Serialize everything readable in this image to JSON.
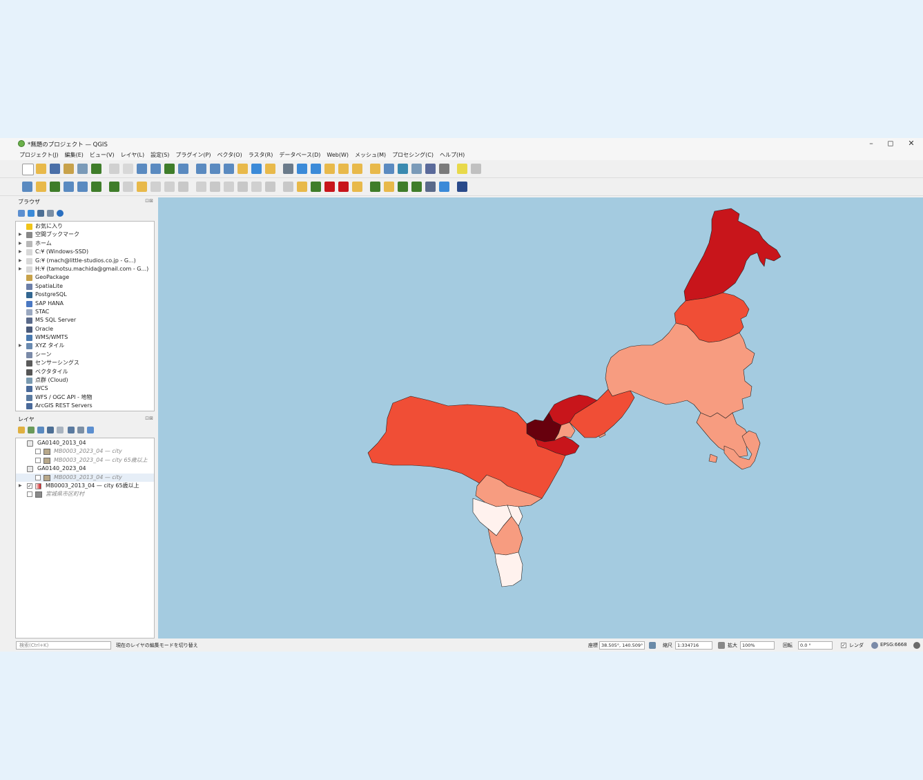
{
  "window": {
    "title": "*無題のプロジェクト — QGIS",
    "controls": {
      "minimize": "–",
      "maximize": "◻",
      "close": "✕"
    }
  },
  "menu": [
    "プロジェクト(J)",
    "編集(E)",
    "ビュー(V)",
    "レイヤ(L)",
    "設定(S)",
    "プラグイン(P)",
    "ベクタ(O)",
    "ラスタ(R)",
    "データベース(D)",
    "Web(W)",
    "メッシュ(M)",
    "プロセシング(C)",
    "ヘルプ(H)"
  ],
  "browser": {
    "title": "ブラウザ",
    "controls": "⊡⊠",
    "items": [
      {
        "label": "お気に入り",
        "icon": "star-icon",
        "color": "#f0c419",
        "expand": false
      },
      {
        "label": "空間ブックマーク",
        "icon": "bookmark-icon",
        "color": "#888888",
        "expand": true
      },
      {
        "label": "ホーム",
        "icon": "home-folder-icon",
        "color": "#b8b8b8",
        "expand": true
      },
      {
        "label": "C:¥ (Windows-SSD)",
        "icon": "drive-icon",
        "color": "#d8d8d8",
        "expand": true
      },
      {
        "label": "G:¥ (mach@little-studios.co.jp - G...)",
        "icon": "drive-icon",
        "color": "#d8d8d8",
        "expand": true
      },
      {
        "label": "H:¥ (tamotsu.machida@gmail.com - G...)",
        "icon": "drive-icon",
        "color": "#d8d8d8",
        "expand": true
      },
      {
        "label": "GeoPackage",
        "icon": "geopackage-icon",
        "color": "#c8a24a",
        "expand": false
      },
      {
        "label": "SpatiaLite",
        "icon": "spatialite-icon",
        "color": "#6c7fa8",
        "expand": false
      },
      {
        "label": "PostgreSQL",
        "icon": "postgresql-icon",
        "color": "#336791",
        "expand": false
      },
      {
        "label": "SAP HANA",
        "icon": "sap-hana-icon",
        "color": "#4a78c2",
        "expand": false
      },
      {
        "label": "STAC",
        "icon": "stac-icon",
        "color": "#9aa8c0",
        "expand": false
      },
      {
        "label": "MS SQL Server",
        "icon": "mssql-icon",
        "color": "#5a6a8a",
        "expand": false
      },
      {
        "label": "Oracle",
        "icon": "oracle-icon",
        "color": "#4a5a7a",
        "expand": false
      },
      {
        "label": "WMS/WMTS",
        "icon": "wms-icon",
        "color": "#4a7ab0",
        "expand": false
      },
      {
        "label": "XYZ タイル",
        "icon": "xyz-tiles-icon",
        "color": "#6a8ab0",
        "expand": true
      },
      {
        "label": "シーン",
        "icon": "scene-icon",
        "color": "#7a8aa8",
        "expand": false
      },
      {
        "label": "センサーシングス",
        "icon": "sensor-icon",
        "color": "#5a5a5a",
        "expand": false
      },
      {
        "label": "ベクタタイル",
        "icon": "vector-tile-icon",
        "color": "#555555",
        "expand": false
      },
      {
        "label": "点群 (Cloud)",
        "icon": "point-cloud-icon",
        "color": "#7a9ab0",
        "expand": false
      },
      {
        "label": "WCS",
        "icon": "wcs-icon",
        "color": "#4a6a9a",
        "expand": false
      },
      {
        "label": "WFS / OGC API - 地物",
        "icon": "wfs-icon",
        "color": "#5a7aa0",
        "expand": false
      },
      {
        "label": "ArcGIS REST Servers",
        "icon": "arcgis-icon",
        "color": "#4a6a9a",
        "expand": false
      }
    ]
  },
  "layers": {
    "title": "レイヤ",
    "controls": "⊡⊠",
    "items": [
      {
        "label": "GA0140_2013_04",
        "type": "table",
        "indent": 0,
        "checkbox": false,
        "checked": false,
        "grey": false,
        "swatch": "",
        "expand": false,
        "selected": false
      },
      {
        "label": "MB0003_2023_04 — city",
        "type": "poly",
        "indent": 1,
        "checkbox": true,
        "checked": false,
        "grey": true,
        "swatch": "#b8a88a",
        "expand": false,
        "selected": false
      },
      {
        "label": "MB0003_2023_04 — city 65歳以上",
        "type": "poly",
        "indent": 1,
        "checkbox": true,
        "checked": false,
        "grey": true,
        "swatch": "#b8a88a",
        "expand": false,
        "selected": false
      },
      {
        "label": "GA0140_2023_04",
        "type": "table",
        "indent": 0,
        "checkbox": false,
        "checked": false,
        "grey": false,
        "swatch": "",
        "expand": false,
        "selected": false
      },
      {
        "label": "MB0003_2013_04 — city",
        "type": "poly",
        "indent": 1,
        "checkbox": true,
        "checked": false,
        "grey": true,
        "swatch": "#b8a88a",
        "expand": false,
        "selected": true
      },
      {
        "label": "MB0003_2013_04 — city 65歳以上",
        "type": "graduated",
        "indent": 0,
        "checkbox": true,
        "checked": true,
        "grey": false,
        "swatch": "",
        "expand": true,
        "selected": false
      },
      {
        "label": "宮城県市区町村",
        "type": "poly",
        "indent": 0,
        "checkbox": true,
        "checked": false,
        "grey": true,
        "swatch": "#8a8a8a",
        "expand": false,
        "selected": false
      }
    ]
  },
  "status": {
    "search_placeholder": "検索(Ctrl+K)",
    "message": "現在のレイヤの編集モードを切り替え",
    "coord_label": "座標",
    "coord_value": "38.505°, 140.509°",
    "scale_label": "縮尺",
    "scale_value": "1:334716",
    "zoom_label": "拡大",
    "zoom_value": "100%",
    "rotation_label": "回転",
    "rotation_value": "0.0 °",
    "render_label": "レンダ",
    "crs": "EPSG:6668"
  },
  "colors": {
    "map_water": "#a4cbe0",
    "class_1": "#fff2ee",
    "class_2": "#f79c80",
    "class_3": "#f04e36",
    "class_4": "#c8151b",
    "class_5": "#67000d"
  }
}
